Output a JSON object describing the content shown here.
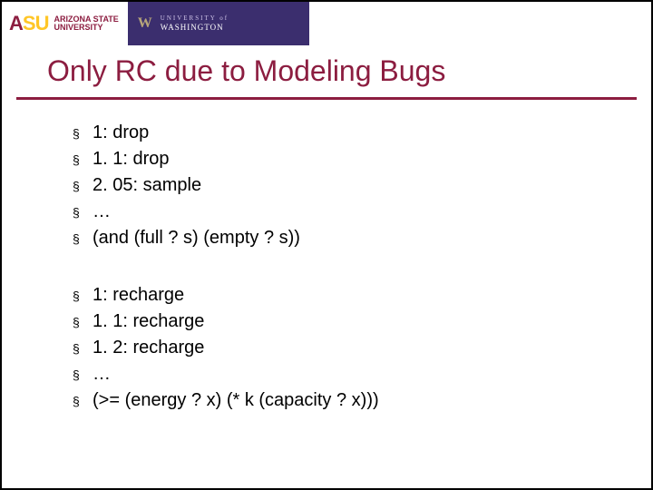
{
  "banner": {
    "asu_mark_1": "A",
    "asu_mark_2": "SU",
    "asu_line1": "ARIZONA STATE",
    "asu_line2": "UNIVERSITY",
    "uw_line1": "UNIVERSITY of",
    "uw_line2": "WASHINGTON",
    "uw_w": "W"
  },
  "title": "Only RC due to Modeling Bugs",
  "group1": {
    "items": [
      "1: drop",
      "1. 1: drop",
      "2. 05: sample",
      "…",
      "(and (full ? s) (empty ? s))"
    ]
  },
  "group2": {
    "items": [
      "1: recharge",
      "1. 1: recharge",
      "1. 2: recharge",
      "…",
      "(>= (energy ? x) (* k (capacity ? x)))"
    ]
  },
  "bullet_char": "§"
}
